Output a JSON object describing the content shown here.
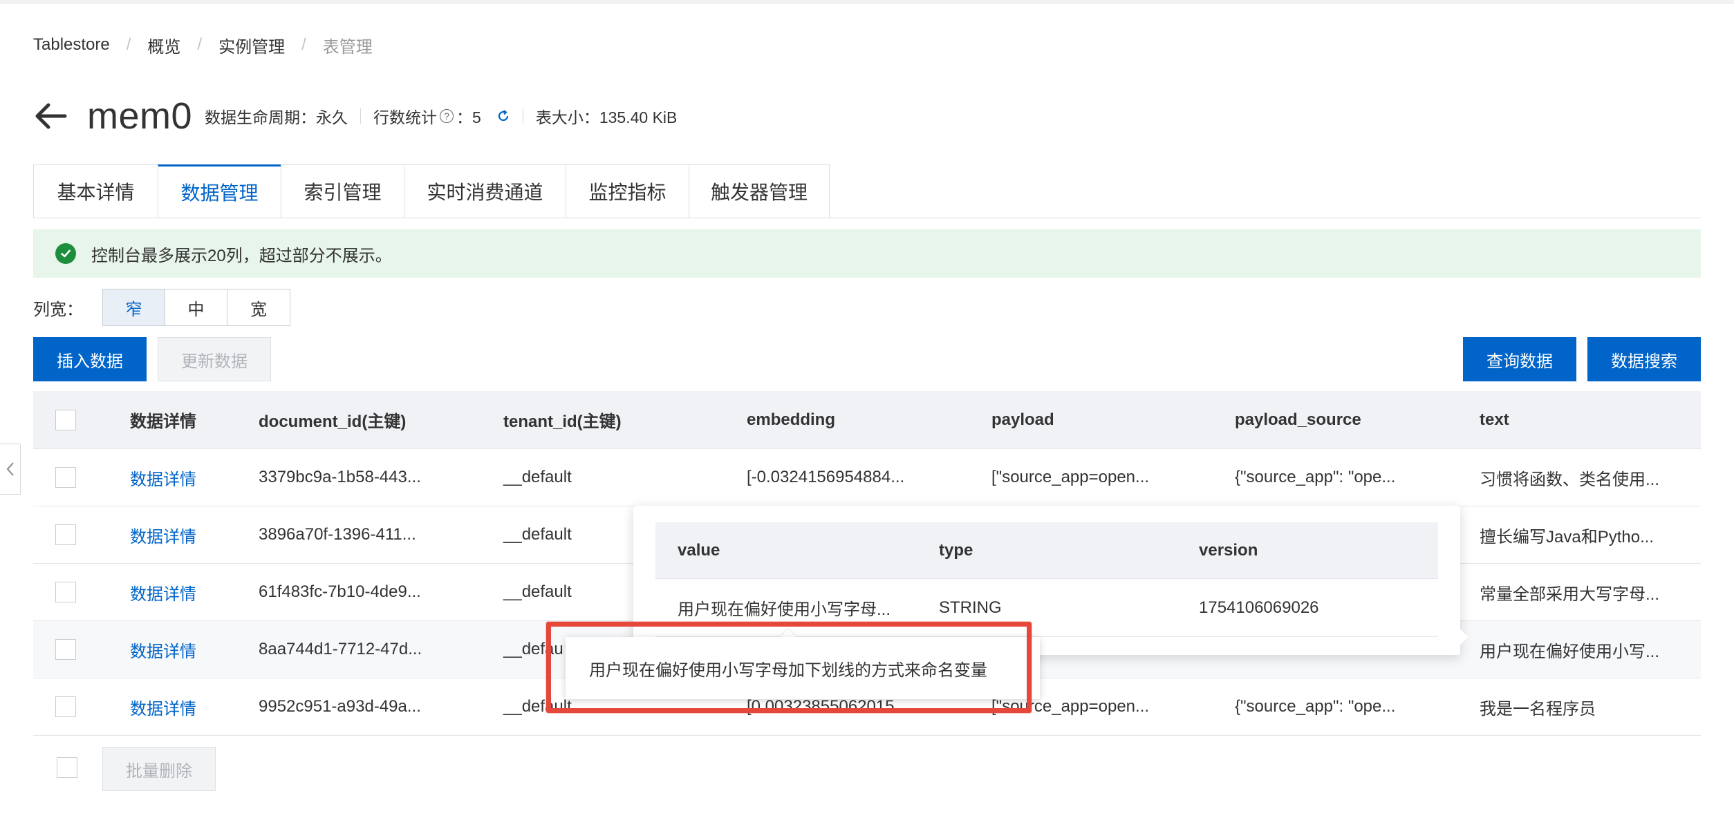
{
  "breadcrumb": [
    "Tablestore",
    "概览",
    "实例管理",
    "表管理"
  ],
  "header": {
    "title": "mem0",
    "lifecycle": "数据生命周期：永久",
    "row_count_label": "行数统计",
    "row_count_value": "：5",
    "table_size": "表大小：135.40 KiB"
  },
  "tabs": [
    {
      "label": "基本详情",
      "active": false
    },
    {
      "label": "数据管理",
      "active": true
    },
    {
      "label": "索引管理",
      "active": false
    },
    {
      "label": "实时消费通道",
      "active": false
    },
    {
      "label": "监控指标",
      "active": false
    },
    {
      "label": "触发器管理",
      "active": false
    }
  ],
  "alert": {
    "text": "控制台最多展示20列，超过部分不展示。",
    "color": "#1e8e3e"
  },
  "column_width": {
    "label": "列宽：",
    "options": [
      "窄",
      "中",
      "宽"
    ],
    "selected": "窄"
  },
  "actions": {
    "insert": "插入数据",
    "update": "更新数据",
    "query": "查询数据",
    "search": "数据搜索",
    "bulk_delete": "批量删除"
  },
  "table": {
    "columns": [
      "数据详情",
      "document_id(主键)",
      "tenant_id(主键)",
      "embedding",
      "payload",
      "payload_source",
      "text"
    ],
    "rows": [
      {
        "detail": "数据详情",
        "document_id": "3379bc9a-1b58-443...",
        "tenant_id": "__default",
        "embedding": "[-0.0324156954884...",
        "payload": "[\"source_app=open...",
        "payload_source": "{\"source_app\": \"ope...",
        "text": "习惯将函数、类名使用..."
      },
      {
        "detail": "数据详情",
        "document_id": "3896a70f-1396-411...",
        "tenant_id": "__default",
        "embedding": "",
        "payload": "",
        "payload_source": "",
        "text": "擅长编写Java和Pytho..."
      },
      {
        "detail": "数据详情",
        "document_id": "61f483fc-7b10-4de9...",
        "tenant_id": "__default",
        "embedding": "",
        "payload": "",
        "payload_source": "",
        "text": "常量全部采用大写字母..."
      },
      {
        "detail": "数据详情",
        "document_id": "8aa744d1-7712-47d...",
        "tenant_id": "__defau",
        "embedding": "",
        "payload": "",
        "payload_source": "",
        "text": "用户现在偏好使用小写..."
      },
      {
        "detail": "数据详情",
        "document_id": "9952c951-a93d-49a...",
        "tenant_id": "__default",
        "embedding": "[0.00323855062015...",
        "payload": "[\"source_app=open...",
        "payload_source": "{\"source_app\": \"ope...",
        "text": "我是一名程序员"
      }
    ]
  },
  "popover": {
    "columns": [
      "value",
      "type",
      "version"
    ],
    "row": {
      "value": "用户现在偏好使用小写字母...",
      "type": "STRING",
      "version": "1754106069026"
    }
  },
  "tooltip": {
    "text": "用户现在偏好使用小写字母加下划线的方式来命名变量"
  },
  "colors": {
    "primary": "#0064c8",
    "highlight": "#e5473b",
    "alert_bg": "#e8f5ea"
  }
}
